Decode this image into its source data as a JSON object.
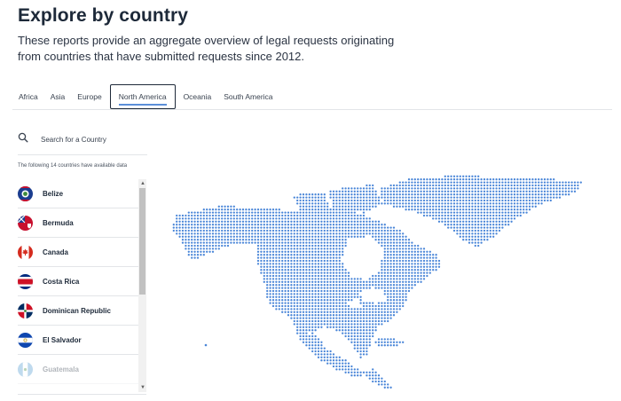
{
  "header": {
    "title": "Explore by country",
    "subtitle": "These reports provide an aggregate overview of legal requests originating from countries that have submitted requests since 2012."
  },
  "tabs": [
    {
      "label": "Africa",
      "active": false
    },
    {
      "label": "Asia",
      "active": false
    },
    {
      "label": "Europe",
      "active": false
    },
    {
      "label": "North America",
      "active": true
    },
    {
      "label": "Oceania",
      "active": false
    },
    {
      "label": "South America",
      "active": false
    }
  ],
  "search": {
    "placeholder": "Search for a Country",
    "icon": "search-icon"
  },
  "list": {
    "note": "The following 14 countries have available data",
    "countries": [
      {
        "label": "Belize"
      },
      {
        "label": "Bermuda"
      },
      {
        "label": "Canada"
      },
      {
        "label": "Costa Rica"
      },
      {
        "label": "Dominican Republic"
      },
      {
        "label": "El Salvador"
      },
      {
        "label": "Guatemala"
      }
    ]
  },
  "colors": {
    "map_dot": "#4a86d8",
    "accent": "#5b8fd9",
    "text": "#1d2939"
  }
}
